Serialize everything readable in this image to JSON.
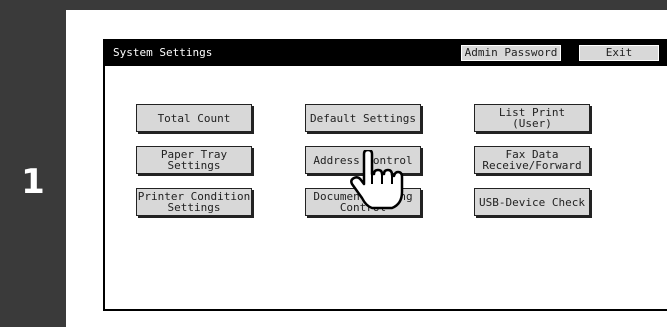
{
  "step": {
    "number": "1"
  },
  "window": {
    "title": "System Settings",
    "admin_password_label": "Admin Password",
    "exit_label": "Exit"
  },
  "buttons": {
    "total_count": "Total Count",
    "default_settings": "Default Settings",
    "list_print": "List Print\n(User)",
    "paper_tray_settings": "Paper Tray\nSettings",
    "address_control": "Address Control",
    "fax_data": "Fax Data\nReceive/Forward",
    "printer_condition": "Printer Condition\nSettings",
    "document_filing": "Document Filing\nControl",
    "usb_device_check": "USB-Device Check"
  },
  "colors": {
    "frame": "#3a3a3a",
    "button_fill": "#d8d8d8",
    "titlebar": "#000000"
  }
}
